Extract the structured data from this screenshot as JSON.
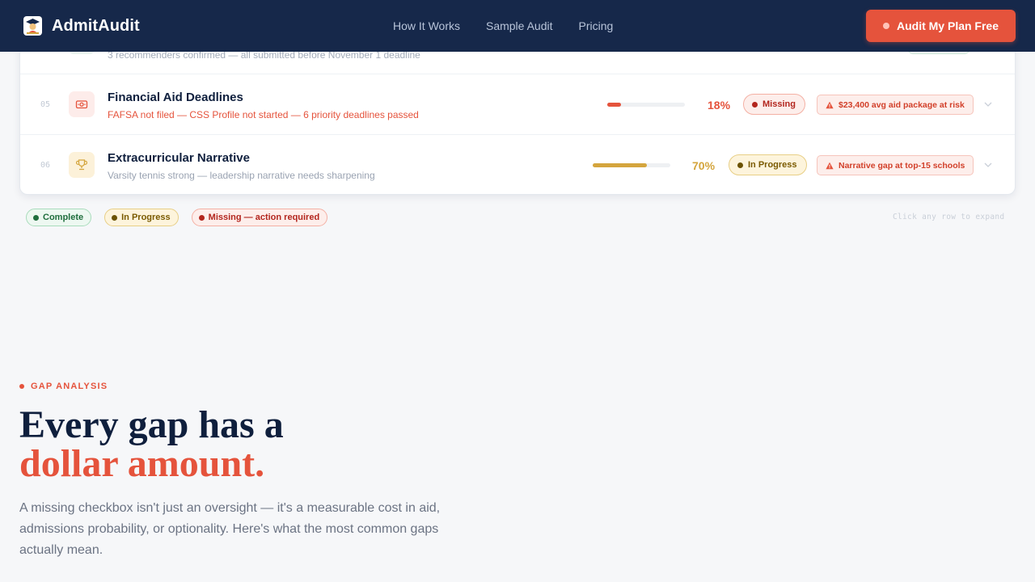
{
  "header": {
    "brand": "AdmitAudit",
    "nav": [
      "How It Works",
      "Sample Audit",
      "Pricing"
    ],
    "cta": "Audit My Plan Free"
  },
  "audit": {
    "partial_row": {
      "subtitle": "3 recommenders confirmed — all submitted before November 1 deadline"
    },
    "rows": [
      {
        "number": "05",
        "icon": "money-icon",
        "title": "Financial Aid Deadlines",
        "subtitle": "FAFSA not filed — CSS Profile not started — 6 priority deadlines passed",
        "progress": 18,
        "progress_label": "18%",
        "status": "Missing",
        "risk": "$23,400 avg aid package at risk"
      },
      {
        "number": "06",
        "icon": "trophy-icon",
        "title": "Extracurricular Narrative",
        "subtitle": "Varsity tennis strong — leadership narrative needs sharpening",
        "progress": 70,
        "progress_label": "70%",
        "status": "In Progress",
        "risk": "Narrative gap at top-15 schools"
      }
    ]
  },
  "legend": {
    "complete": "Complete",
    "in_progress": "In Progress",
    "missing": "Missing — action required",
    "hint": "Click any row to expand"
  },
  "gap_section": {
    "eyebrow": "GAP ANALYSIS",
    "headline_line1": "Every gap has a",
    "headline_line2": "dollar amount.",
    "lead": "A missing checkbox isn't just an oversight — it's a measurable cost in aid, admissions probability, or optionality. Here's what the most common gaps actually mean."
  },
  "colors": {
    "navy": "#16284a",
    "accent": "#e5533c",
    "gold": "#d4a53d",
    "complete_green": "#1f6e3d",
    "missing_red": "#b3261e"
  }
}
